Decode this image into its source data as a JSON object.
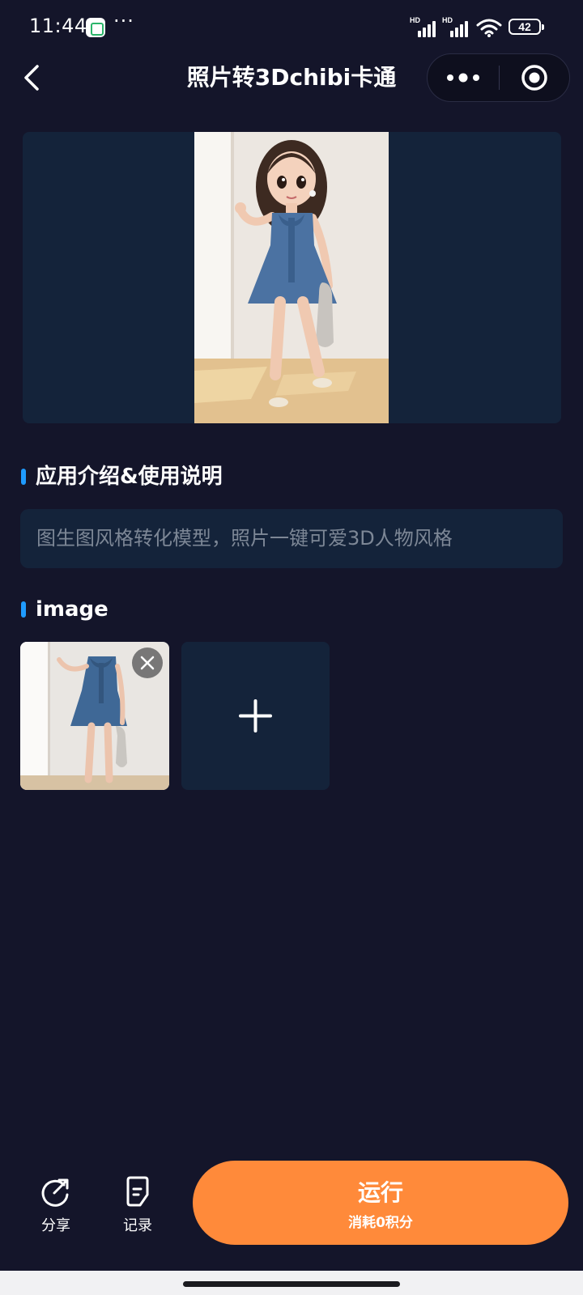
{
  "status_bar": {
    "time": "11:44",
    "more": "···",
    "signal_1_label": "HD",
    "signal_2_label": "HD",
    "battery": "42"
  },
  "nav": {
    "title": "照片转3Dchibi卡通",
    "back_icon": "chevron-left-icon",
    "more_icon": "more-dots-icon",
    "close_icon": "target-close-icon"
  },
  "intro": {
    "title": "应用介绍&使用说明",
    "text": "图生图风格转化模型，照片一键可爱3D人物风格"
  },
  "image_section": {
    "title": "image"
  },
  "toolbar": {
    "share_label": "分享",
    "record_label": "记录",
    "run_label": "运行",
    "run_cost": "消耗0积分"
  },
  "colors": {
    "background": "#14152a",
    "panel": "#14233a",
    "accent": "#1f9bff",
    "run_button": "#ff8a3a"
  }
}
